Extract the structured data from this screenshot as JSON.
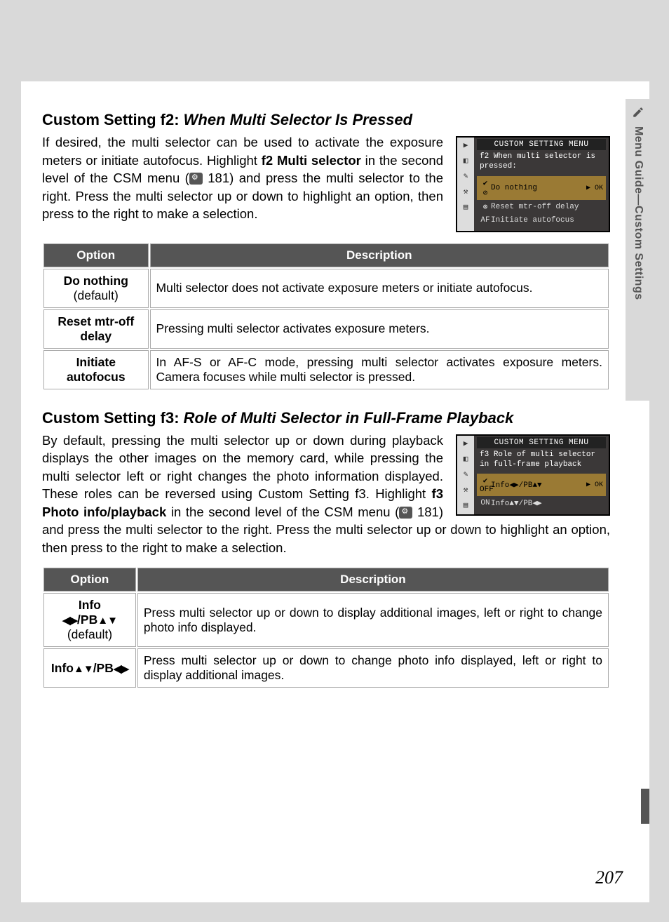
{
  "sideTab": {
    "label": "Menu Guide—Custom Settings"
  },
  "page_number": "207",
  "s1": {
    "heading_prefix": "Custom Setting f2: ",
    "heading_title": "When Multi Selector Is Pressed",
    "para_a": "If desired, the multi selector can be used to activate the exposure meters or initiate autofocus. Highlight ",
    "para_bold1": "f2 Multi selector",
    "para_b": " in the second level of the CSM menu (",
    "para_ref": " 181) and press the multi selector to the right.  Press the multi selector up or down to highlight an option, then press to the right to make a selection.",
    "screen": {
      "title": "CUSTOM SETTING MENU",
      "sub1": "f2",
      "sub2": "When multi selector is pressed:",
      "row1": "Do nothing",
      "row1_ok": "▶ OK",
      "row2": "Reset mtr-off delay",
      "row3": "Initiate autofocus",
      "row3_ind": "AF"
    },
    "table": {
      "h1": "Option",
      "h2": "Description",
      "r1_opt": "Do nothing",
      "r1_def": "(default)",
      "r1_desc": "Multi selector does not activate exposure meters or initiate autofocus.",
      "r2_opt": "Reset mtr-off delay",
      "r2_desc": "Pressing multi selector activates exposure meters.",
      "r3_opt": "Initiate autofocus",
      "r3_desc": "In AF-S or AF-C mode, pressing multi selector activates exposure meters.  Camera focuses while multi selector is pressed."
    }
  },
  "s2": {
    "heading_prefix": "Custom Setting f3: ",
    "heading_title": "Role of Multi Selector in Full-Frame Playback",
    "para_a": "By default, pressing the multi selector up or down during playback displays the other images on the memory card, while pressing the multi selector left or right changes the photo information displayed.  These roles can be reversed using Custom Setting f3.  Highlight ",
    "para_bold1": "f3 Photo info/playback",
    "para_b": " in the second level of the CSM menu (",
    "para_ref": " 181) and press the multi selector to the right.  Press the multi selector up or down to highlight an option, then press to the right to make a selection.",
    "screen": {
      "title": "CUSTOM SETTING MENU",
      "sub1": "f3",
      "sub2": "Role of multi selector in full-frame playback",
      "row1_ind": "✔ OFF",
      "row1": "Info◀▶/PB▲▼",
      "row1_ok": "▶ OK",
      "row2_ind": "ON",
      "row2": "Info▲▼/PB◀▶"
    },
    "table": {
      "h1": "Option",
      "h2": "Description",
      "r1_opt_a": "Info ",
      "r1_opt_arr1": "◀▶",
      "r1_opt_b": "/PB",
      "r1_opt_arr2": "▲▼",
      "r1_def": "(default)",
      "r1_desc": "Press multi selector up or down to display additional images, left or right to change photo info displayed.",
      "r2_opt_a": "Info",
      "r2_opt_arr1": "▲▼",
      "r2_opt_b": "/PB",
      "r2_opt_arr2": "◀▶",
      "r2_desc": "Press multi selector up or down to change photo info displayed, left or right to display additional images."
    }
  }
}
